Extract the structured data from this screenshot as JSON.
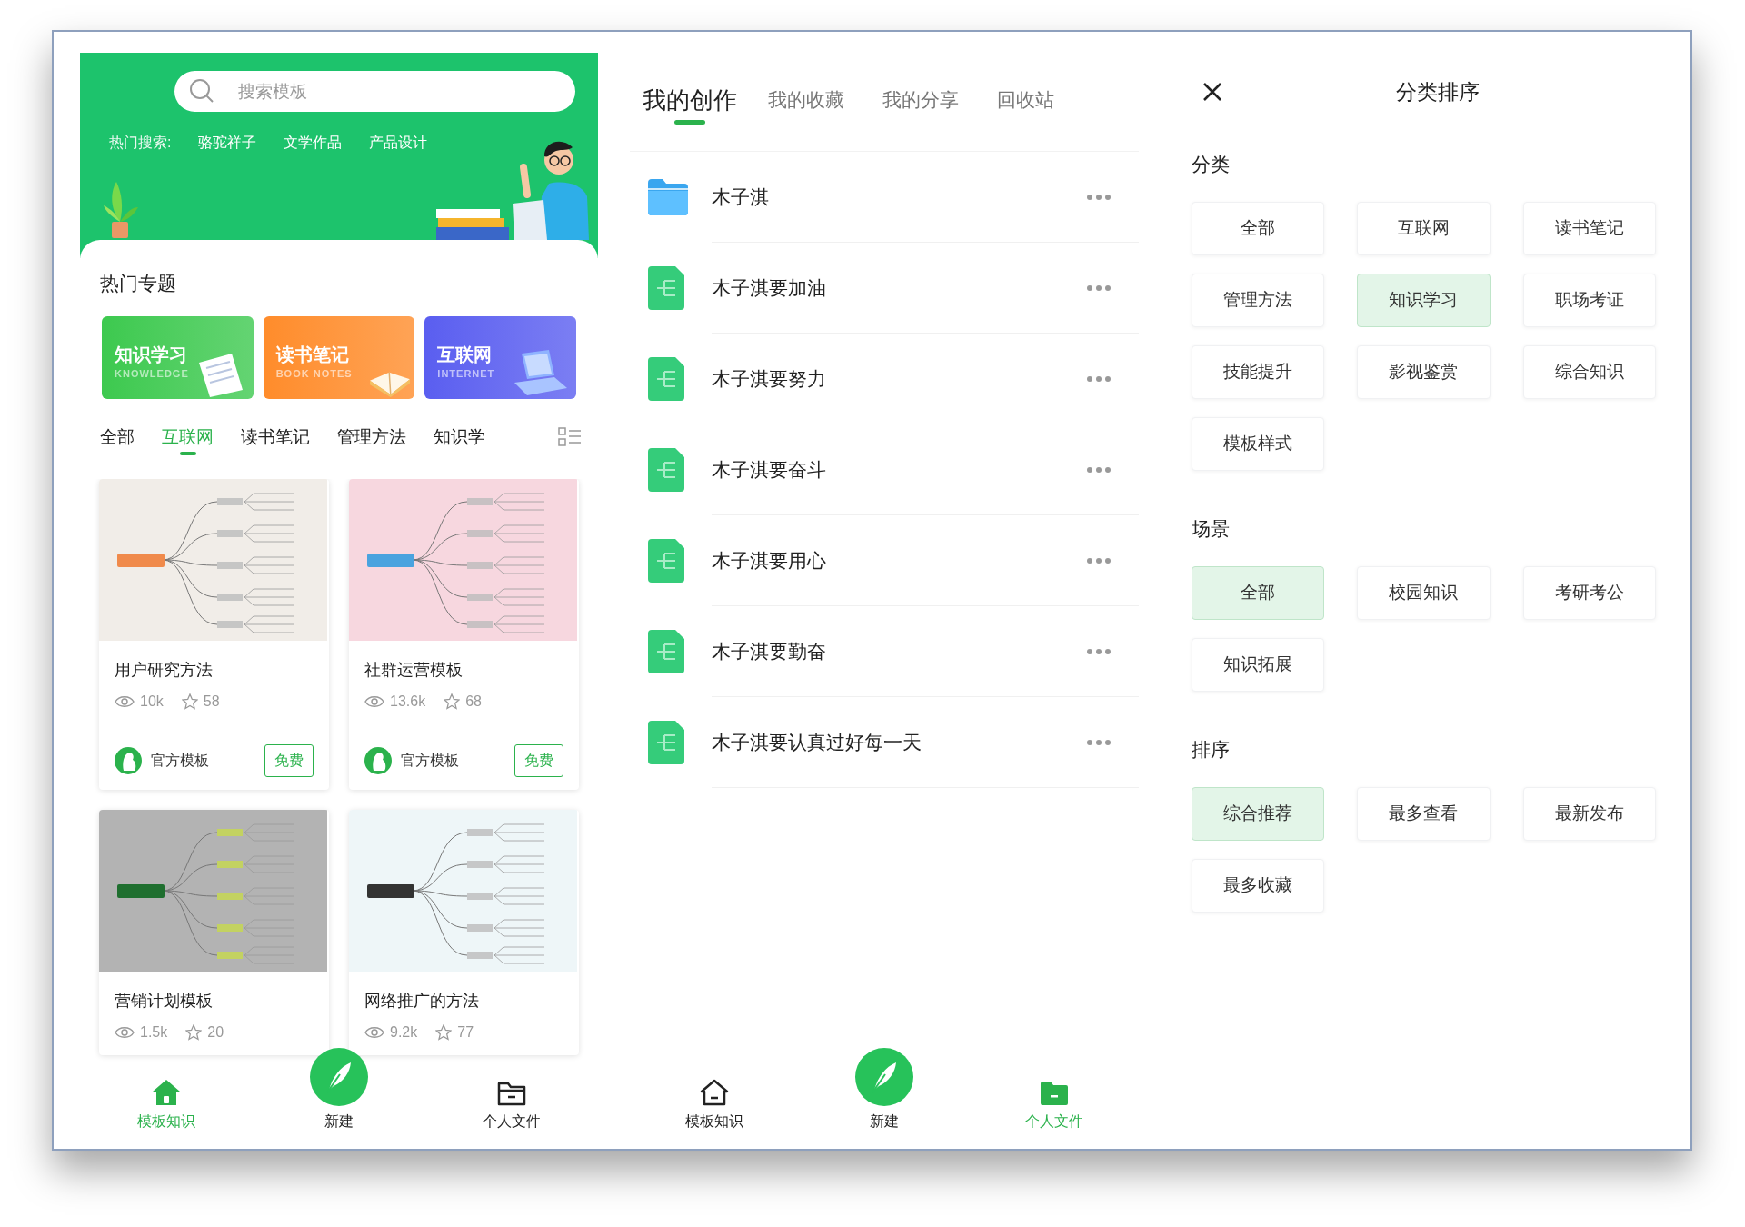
{
  "left_screen": {
    "search": {
      "placeholder": "搜索模板"
    },
    "hot_search": {
      "label": "热门搜索:",
      "terms": [
        "骆驼祥子",
        "文学作品",
        "产品设计"
      ]
    },
    "topics_title": "热门专题",
    "topics": [
      {
        "title": "知识学习",
        "subtitle": "KNOWLEDGE",
        "kind": "notebook",
        "color": "#3dc94f"
      },
      {
        "title": "读书笔记",
        "subtitle": "BOOK NOTES",
        "kind": "book",
        "color": "#ff8c2b"
      },
      {
        "title": "互联网",
        "subtitle": "INTERNET",
        "kind": "laptop",
        "color": "#5a5ef0"
      }
    ],
    "category_tabs": [
      {
        "label": "全部",
        "selected": false
      },
      {
        "label": "互联网",
        "selected": true
      },
      {
        "label": "读书笔记",
        "selected": false
      },
      {
        "label": "管理方法",
        "selected": false
      },
      {
        "label": "知识学",
        "selected": false
      }
    ],
    "templates": [
      {
        "title": "用户研究方法",
        "views": "10k",
        "favorites": "58",
        "author": "官方模板",
        "price": "免费",
        "color": "#f1ede8"
      },
      {
        "title": "社群运营模板",
        "views": "13.6k",
        "favorites": "68",
        "author": "官方模板",
        "price": "免费",
        "color": "#f7d7df"
      },
      {
        "title": "营销计划模板",
        "views": "1.5k",
        "favorites": "20",
        "color": "#b3b3b3"
      },
      {
        "title": "网络推广的方法",
        "views": "9.2k",
        "favorites": "77",
        "color": "#eef6f8"
      }
    ],
    "bottom_nav": [
      {
        "label": "模板知识",
        "kind": "home",
        "selected": true
      },
      {
        "label": "新建",
        "kind": "create",
        "selected": false
      },
      {
        "label": "个人文件",
        "kind": "folder",
        "selected": false
      }
    ]
  },
  "middle_screen": {
    "tabs": [
      {
        "label": "我的创作",
        "selected": true
      },
      {
        "label": "我的收藏",
        "selected": false
      },
      {
        "label": "我的分享",
        "selected": false
      },
      {
        "label": "回收站",
        "selected": false
      }
    ],
    "files": [
      {
        "name": "木子淇",
        "kind": "folder"
      },
      {
        "name": "木子淇要加油",
        "kind": "mindmap"
      },
      {
        "name": "木子淇要努力",
        "kind": "mindmap"
      },
      {
        "name": "木子淇要奋斗",
        "kind": "mindmap"
      },
      {
        "name": "木子淇要用心",
        "kind": "mindmap"
      },
      {
        "name": "木子淇要勤奋",
        "kind": "mindmap"
      },
      {
        "name": "木子淇要认真过好每一天",
        "kind": "mindmap"
      }
    ],
    "bottom_nav": [
      {
        "label": "模板知识",
        "kind": "home",
        "selected": false
      },
      {
        "label": "新建",
        "kind": "create",
        "selected": false
      },
      {
        "label": "个人文件",
        "kind": "folder",
        "selected": true
      }
    ]
  },
  "right_screen": {
    "title": "分类排序",
    "sections": [
      {
        "heading": "分类",
        "options": [
          {
            "label": "全部",
            "selected": false
          },
          {
            "label": "互联网",
            "selected": false
          },
          {
            "label": "读书笔记",
            "selected": false
          },
          {
            "label": "管理方法",
            "selected": false
          },
          {
            "label": "知识学习",
            "selected": true
          },
          {
            "label": "职场考证",
            "selected": false
          },
          {
            "label": "技能提升",
            "selected": false
          },
          {
            "label": "影视鉴赏",
            "selected": false
          },
          {
            "label": "综合知识",
            "selected": false
          },
          {
            "label": "模板样式",
            "selected": false
          }
        ]
      },
      {
        "heading": "场景",
        "options": [
          {
            "label": "全部",
            "selected": true
          },
          {
            "label": "校园知识",
            "selected": false
          },
          {
            "label": "考研考公",
            "selected": false
          },
          {
            "label": "知识拓展",
            "selected": false
          }
        ]
      },
      {
        "heading": "排序",
        "options": [
          {
            "label": "综合推荐",
            "selected": true
          },
          {
            "label": "最多查看",
            "selected": false
          },
          {
            "label": "最新发布",
            "selected": false
          },
          {
            "label": "最多收藏",
            "selected": false
          }
        ]
      }
    ]
  }
}
